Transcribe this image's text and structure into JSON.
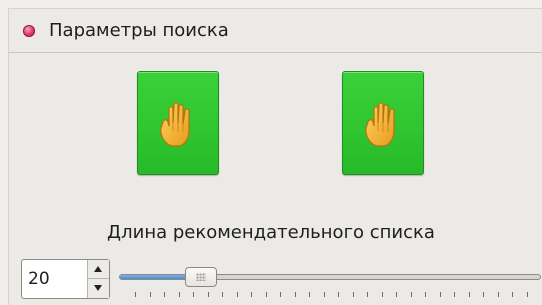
{
  "panel": {
    "title": "Параметры поиска",
    "header_icon": "pink-bullet-icon"
  },
  "buttons": {
    "left_icon": "hand-icon",
    "right_icon": "hand-icon",
    "color": "#2fc52f"
  },
  "recommendation_length": {
    "label": "Длина рекомендательного списка",
    "value": "20",
    "slider_value": 20,
    "slider_min": 0,
    "slider_max": 200,
    "tick_count": 28
  }
}
